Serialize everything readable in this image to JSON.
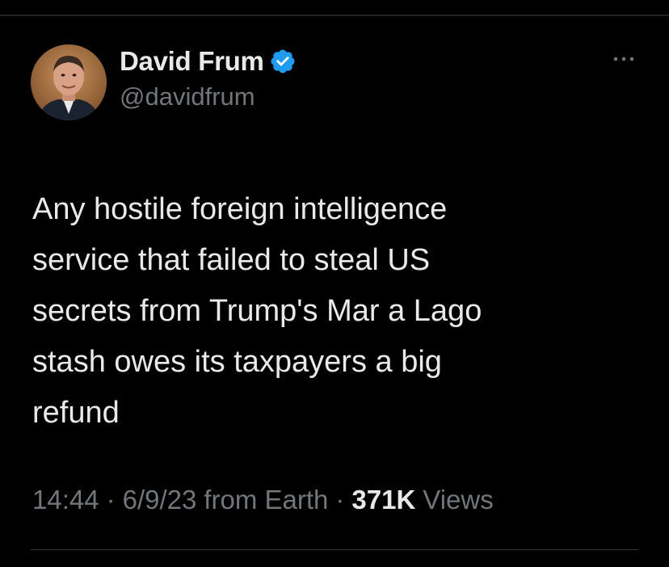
{
  "author": {
    "display_name": "David Frum",
    "handle": "@davidfrum",
    "verified": true,
    "avatar_icon": "profile-photo"
  },
  "more_icon": "more-horizontal-icon",
  "tweet": {
    "text": "Any hostile foreign intelligence\nservice that failed to steal US\nsecrets from Trump's Mar a Lago\nstash owes its taxpayers a big\nrefund"
  },
  "meta": {
    "time": "14:44",
    "separator": "·",
    "date": "6/9/23",
    "source": "from Earth",
    "views_count": "371K",
    "views_label": "Views"
  },
  "colors": {
    "background": "#000000",
    "text_primary": "#e7e9ea",
    "text_secondary": "#71767b",
    "verified_badge": "#1d9bf0",
    "divider": "#2f3336"
  }
}
